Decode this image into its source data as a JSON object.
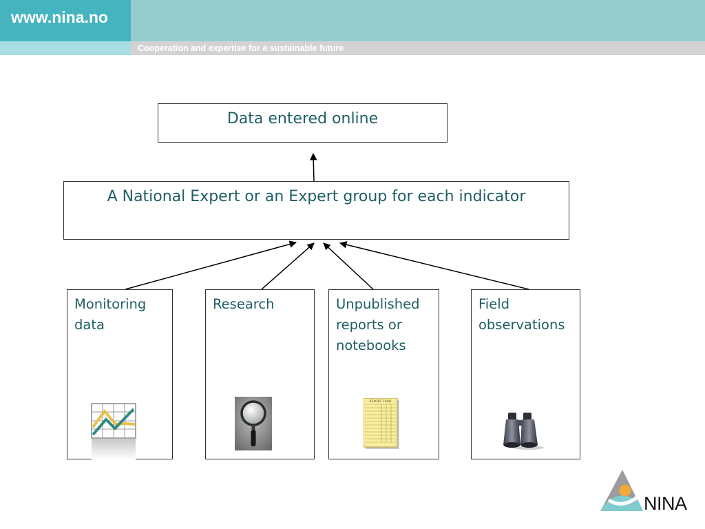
{
  "header": {
    "site_url": "www.nina.no",
    "tagline": "Cooperation and expertise for a sustainable future"
  },
  "diagram": {
    "top_box": "Data entered online",
    "middle_box": "A National Expert or an Expert group for each indicator",
    "sources": [
      {
        "label": "Monitoring\ndata",
        "icon": "chart-icon"
      },
      {
        "label": "Research",
        "icon": "magnifying-glass-icon"
      },
      {
        "label": "Unpublished\nreports or\nnotebooks",
        "icon": "report-card-icon"
      },
      {
        "label": "Field\nobservations",
        "icon": "binoculars-icon"
      }
    ]
  },
  "report_card_heading": "REPORT CARD",
  "logo": {
    "text": "NINA"
  },
  "colors": {
    "header_accent": "#46b4bf",
    "header_band": "#97cccc",
    "text_teal": "#1f5e63"
  }
}
